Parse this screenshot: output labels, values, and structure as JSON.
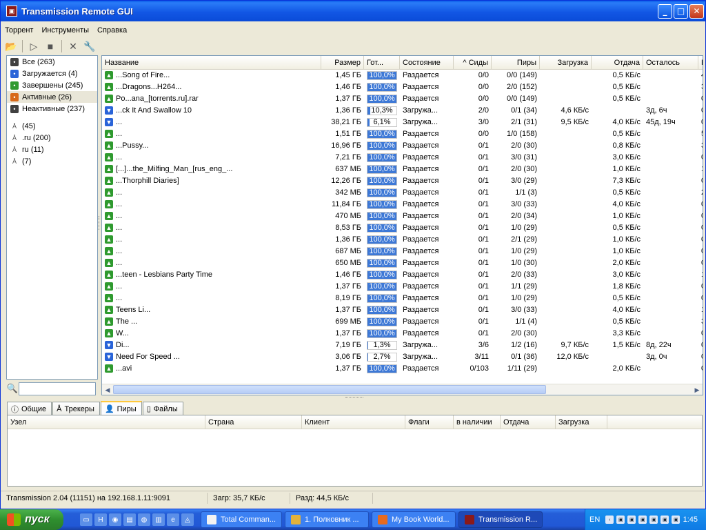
{
  "window": {
    "title": "Transmission Remote GUI"
  },
  "menu": [
    "Торрент",
    "Инструменты",
    "Справка"
  ],
  "filters": {
    "status": [
      {
        "label": "Все (263)",
        "icon": "all-icon",
        "color": "#404040"
      },
      {
        "label": "Загружается (4)",
        "icon": "download-icon",
        "color": "#2a64d8"
      },
      {
        "label": "Завершены (245)",
        "icon": "completed-icon",
        "color": "#2f9a2f"
      },
      {
        "label": "Активные (26)",
        "icon": "active-icon",
        "color": "#d86a1a"
      },
      {
        "label": "Неактивные (237)",
        "icon": "inactive-icon",
        "color": "#404040"
      }
    ],
    "trackers": [
      {
        "label": "(45)",
        "icon": "tracker-icon"
      },
      {
        "label": ".ru (200)",
        "icon": "tracker-icon"
      },
      {
        "label": "ru (11)",
        "icon": "tracker-icon"
      },
      {
        "label": "(7)",
        "icon": "tracker-icon"
      }
    ]
  },
  "search": {
    "value": ""
  },
  "torrents": {
    "columns": [
      "Название",
      "Размер",
      "Гот...",
      "Состояние",
      "^ Сиды",
      "Пиры",
      "Загрузка",
      "Отдача",
      "Осталось",
      "К"
    ],
    "rows": [
      {
        "name": "...Song of Fire...",
        "size": "1,45 ГБ",
        "done": "100,0%",
        "pct": 1.0,
        "state": "Раздается",
        "seeds": "0/0",
        "peers": "0/0 (149)",
        "dl": "",
        "ul": "0,5 КБ/с",
        "eta": "",
        "k": "4",
        "icon": "up"
      },
      {
        "name": "...Dragons...H264...",
        "size": "1,46 ГБ",
        "done": "100,0%",
        "pct": 1.0,
        "state": "Раздается",
        "seeds": "0/0",
        "peers": "2/0 (152)",
        "dl": "",
        "ul": "0,5 КБ/с",
        "eta": "",
        "k": "3",
        "icon": "up"
      },
      {
        "name": "Po...ana_[torrents.ru].rar",
        "size": "1,37 ГБ",
        "done": "100,0%",
        "pct": 1.0,
        "state": "Раздается",
        "seeds": "0/0",
        "peers": "0/0 (149)",
        "dl": "",
        "ul": "0,5 КБ/с",
        "eta": "",
        "k": "0",
        "icon": "up"
      },
      {
        "name": "...ck It And Swallow 10",
        "size": "1,36 ГБ",
        "done": "10,3%",
        "pct": 0.103,
        "state": "Загружа...",
        "seeds": "2/0",
        "peers": "0/1 (34)",
        "dl": "4,6 КБ/с",
        "ul": "",
        "eta": "3д, 6ч",
        "k": "0",
        "icon": "dn"
      },
      {
        "name": "...",
        "size": "38,21 ГБ",
        "done": "6,1%",
        "pct": 0.061,
        "state": "Загружа...",
        "seeds": "3/0",
        "peers": "2/1 (31)",
        "dl": "9,5 КБ/с",
        "ul": "4,0 КБ/с",
        "eta": "45д, 19ч",
        "k": "0",
        "icon": "dn"
      },
      {
        "name": "...",
        "size": "1,51 ГБ",
        "done": "100,0%",
        "pct": 1.0,
        "state": "Раздается",
        "seeds": "0/0",
        "peers": "1/0 (158)",
        "dl": "",
        "ul": "0,5 КБ/с",
        "eta": "",
        "k": "5",
        "icon": "up"
      },
      {
        "name": "...Pussy...",
        "size": "16,96 ГБ",
        "done": "100,0%",
        "pct": 1.0,
        "state": "Раздается",
        "seeds": "0/1",
        "peers": "2/0 (30)",
        "dl": "",
        "ul": "0,8 КБ/с",
        "eta": "",
        "k": "3",
        "icon": "up"
      },
      {
        "name": "...",
        "size": "7,21 ГБ",
        "done": "100,0%",
        "pct": 1.0,
        "state": "Раздается",
        "seeds": "0/1",
        "peers": "3/0 (31)",
        "dl": "",
        "ul": "3,0 КБ/с",
        "eta": "",
        "k": "0",
        "icon": "up"
      },
      {
        "name": "[...]...the_Milfing_Man_[rus_eng_...",
        "size": "637 МБ",
        "done": "100,0%",
        "pct": 1.0,
        "state": "Раздается",
        "seeds": "0/1",
        "peers": "2/0 (30)",
        "dl": "",
        "ul": "1,0 КБ/с",
        "eta": "",
        "k": "1",
        "icon": "up"
      },
      {
        "name": "...Thorphill Diaries]",
        "size": "12,26 ГБ",
        "done": "100,0%",
        "pct": 1.0,
        "state": "Раздается",
        "seeds": "0/1",
        "peers": "3/0 (29)",
        "dl": "",
        "ul": "7,3 КБ/с",
        "eta": "",
        "k": "0",
        "icon": "up"
      },
      {
        "name": "...",
        "size": "342 МБ",
        "done": "100,0%",
        "pct": 1.0,
        "state": "Раздается",
        "seeds": "0/1",
        "peers": "1/1 (3)",
        "dl": "",
        "ul": "0,5 КБ/с",
        "eta": "",
        "k": "2",
        "icon": "up"
      },
      {
        "name": "...",
        "size": "11,84 ГБ",
        "done": "100,0%",
        "pct": 1.0,
        "state": "Раздается",
        "seeds": "0/1",
        "peers": "3/0 (33)",
        "dl": "",
        "ul": "4,0 КБ/с",
        "eta": "",
        "k": "0",
        "icon": "up"
      },
      {
        "name": "...",
        "size": "470 МБ",
        "done": "100,0%",
        "pct": 1.0,
        "state": "Раздается",
        "seeds": "0/1",
        "peers": "2/0 (34)",
        "dl": "",
        "ul": "1,0 КБ/с",
        "eta": "",
        "k": "0",
        "icon": "up"
      },
      {
        "name": "...",
        "size": "8,53 ГБ",
        "done": "100,0%",
        "pct": 1.0,
        "state": "Раздается",
        "seeds": "0/1",
        "peers": "1/0 (29)",
        "dl": "",
        "ul": "0,5 КБ/с",
        "eta": "",
        "k": "0",
        "icon": "up"
      },
      {
        "name": "...",
        "size": "1,36 ГБ",
        "done": "100,0%",
        "pct": 1.0,
        "state": "Раздается",
        "seeds": "0/1",
        "peers": "2/1 (29)",
        "dl": "",
        "ul": "1,0 КБ/с",
        "eta": "",
        "k": "0",
        "icon": "up"
      },
      {
        "name": "...",
        "size": "687 МБ",
        "done": "100,0%",
        "pct": 1.0,
        "state": "Раздается",
        "seeds": "0/1",
        "peers": "1/0 (29)",
        "dl": "",
        "ul": "1,0 КБ/с",
        "eta": "",
        "k": "0",
        "icon": "up"
      },
      {
        "name": "...",
        "size": "650 МБ",
        "done": "100,0%",
        "pct": 1.0,
        "state": "Раздается",
        "seeds": "0/1",
        "peers": "1/0 (30)",
        "dl": "",
        "ul": "2,0 КБ/с",
        "eta": "",
        "k": "0",
        "icon": "up"
      },
      {
        "name": "...teen - Lesbians Party Time",
        "size": "1,46 ГБ",
        "done": "100,0%",
        "pct": 1.0,
        "state": "Раздается",
        "seeds": "0/1",
        "peers": "2/0 (33)",
        "dl": "",
        "ul": "3,0 КБ/с",
        "eta": "",
        "k": "1",
        "icon": "up"
      },
      {
        "name": "...",
        "size": "1,37 ГБ",
        "done": "100,0%",
        "pct": 1.0,
        "state": "Раздается",
        "seeds": "0/1",
        "peers": "1/1 (29)",
        "dl": "",
        "ul": "1,8 КБ/с",
        "eta": "",
        "k": "0",
        "icon": "up"
      },
      {
        "name": "...",
        "size": "8,19 ГБ",
        "done": "100,0%",
        "pct": 1.0,
        "state": "Раздается",
        "seeds": "0/1",
        "peers": "1/0 (29)",
        "dl": "",
        "ul": "0,5 КБ/с",
        "eta": "",
        "k": "0",
        "icon": "up"
      },
      {
        "name": "Teens Li...",
        "size": "1,37 ГБ",
        "done": "100,0%",
        "pct": 1.0,
        "state": "Раздается",
        "seeds": "0/1",
        "peers": "3/0 (33)",
        "dl": "",
        "ul": "4,0 КБ/с",
        "eta": "",
        "k": "1",
        "icon": "up"
      },
      {
        "name": "The ...",
        "size": "699 МБ",
        "done": "100,0%",
        "pct": 1.0,
        "state": "Раздается",
        "seeds": "0/1",
        "peers": "1/1 (4)",
        "dl": "",
        "ul": "0,5 КБ/с",
        "eta": "",
        "k": "3",
        "icon": "up"
      },
      {
        "name": "W...",
        "size": "1,37 ГБ",
        "done": "100,0%",
        "pct": 1.0,
        "state": "Раздается",
        "seeds": "0/1",
        "peers": "2/0 (30)",
        "dl": "",
        "ul": "3,3 КБ/с",
        "eta": "",
        "k": "0",
        "icon": "up"
      },
      {
        "name": "Di...",
        "size": "7,19 ГБ",
        "done": "1,3%",
        "pct": 0.013,
        "state": "Загружа...",
        "seeds": "3/6",
        "peers": "1/2 (16)",
        "dl": "9,7 КБ/с",
        "ul": "1,5 КБ/с",
        "eta": "8д, 22ч",
        "k": "0",
        "icon": "dn"
      },
      {
        "name": "Need For Speed ...",
        "size": "3,06 ГБ",
        "done": "2,7%",
        "pct": 0.027,
        "state": "Загружа...",
        "seeds": "3/11",
        "peers": "0/1 (36)",
        "dl": "12,0 КБ/с",
        "ul": "",
        "eta": "3д, 0ч",
        "k": "0",
        "icon": "dn"
      },
      {
        "name": "...avi",
        "size": "1,37 ГБ",
        "done": "100,0%",
        "pct": 1.0,
        "state": "Раздается",
        "seeds": "0/103",
        "peers": "1/11 (29)",
        "dl": "",
        "ul": "2,0 КБ/с",
        "eta": "",
        "k": "0",
        "icon": "up"
      }
    ]
  },
  "tabs": [
    {
      "label": "Общие",
      "icon": "info-icon"
    },
    {
      "label": "Трекеры",
      "icon": "tracker-icon"
    },
    {
      "label": "Пиры",
      "icon": "peers-icon",
      "active": true
    },
    {
      "label": "Файлы",
      "icon": "files-icon"
    }
  ],
  "peers": {
    "columns": [
      "Узел",
      "Страна",
      "Клиент",
      "Флаги",
      "в наличии",
      "Отдача",
      "Загрузка"
    ]
  },
  "status": {
    "connection": "Transmission 2.04 (11151) на 192.168.1.11:9091",
    "download": "Загр: 35,7 КБ/с",
    "upload": "Разд: 44,5 КБ/с"
  },
  "taskbar": {
    "start": "пуск",
    "items": [
      {
        "label": "Total Comman...",
        "icon": "total-commander-icon"
      },
      {
        "label": "1. Полковник ...",
        "icon": "winamp-icon"
      },
      {
        "label": "My Book World...",
        "icon": "firefox-icon"
      },
      {
        "label": "Transmission R...",
        "icon": "transmission-icon",
        "active": true
      }
    ],
    "lang": "EN",
    "clock": "1:45"
  },
  "colors": {
    "titlebar": "#0a5ce8",
    "progress": "#3d78d6",
    "seeding": "#2f9a2f",
    "downloading": "#2a64d8"
  }
}
